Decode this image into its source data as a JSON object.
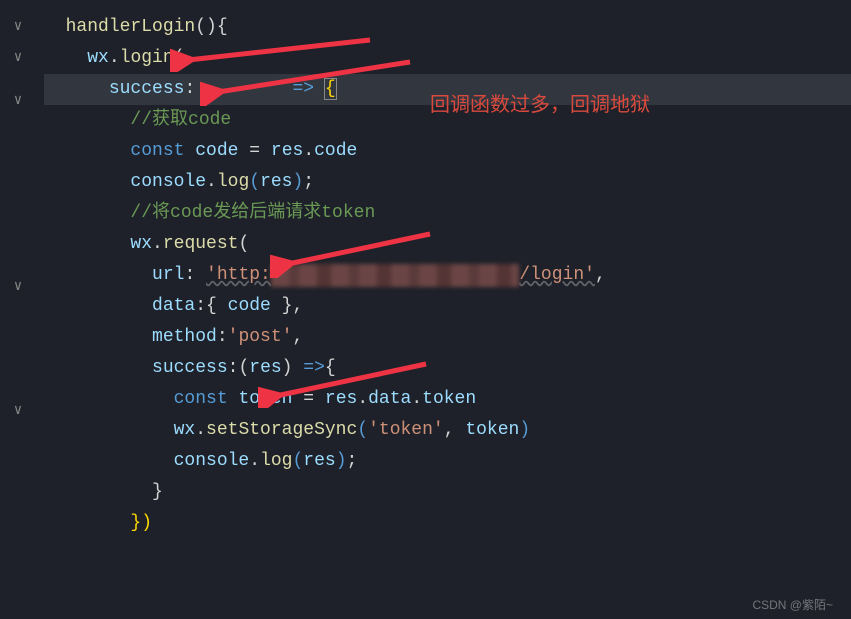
{
  "annotation": "回调函数过多，回调地狱",
  "watermark": "CSDN @紫陌~",
  "code": {
    "l1": {
      "fn": "handlerLogin",
      "rest": "(){"
    },
    "l2": {
      "obj": "wx",
      "method": "login",
      "rest": "("
    },
    "l3": {
      "prop": "success",
      "punc1": ":",
      "arg": "",
      "arw": "=>",
      "brace": "{"
    },
    "l4": {
      "comment": "//获取code"
    },
    "l5": {
      "kw": "const",
      "var": "code",
      "eq": "=",
      "obj": "res",
      "prop": "code"
    },
    "l6": {
      "obj": "console",
      "method": "log",
      "arg": "res"
    },
    "l7": {
      "comment": "//将code发给后端请求token"
    },
    "l8": {
      "obj": "wx",
      "method": "request",
      "rest": "("
    },
    "l9": {
      "prop": "url",
      "str1": "'http:",
      "blur": "                       ",
      "str2": "/login'",
      "comma": ","
    },
    "l10": {
      "prop": "data",
      "var": "code"
    },
    "l11": {
      "prop": "method",
      "str": "'post'",
      "comma": ","
    },
    "l12": {
      "prop": "success",
      "arg": "res",
      "arw": "=>"
    },
    "l13": {
      "kw": "const",
      "var": "token",
      "eq": "=",
      "obj": "res",
      "p1": "data",
      "p2": "token"
    },
    "l14": {
      "obj": "wx",
      "method": "setStorageSync",
      "str": "'token'",
      "var": "token"
    },
    "l15": {
      "obj": "console",
      "method": "log",
      "arg": "res"
    },
    "l16": {
      "brace": "}"
    },
    "l17": {
      "close": "})"
    }
  }
}
